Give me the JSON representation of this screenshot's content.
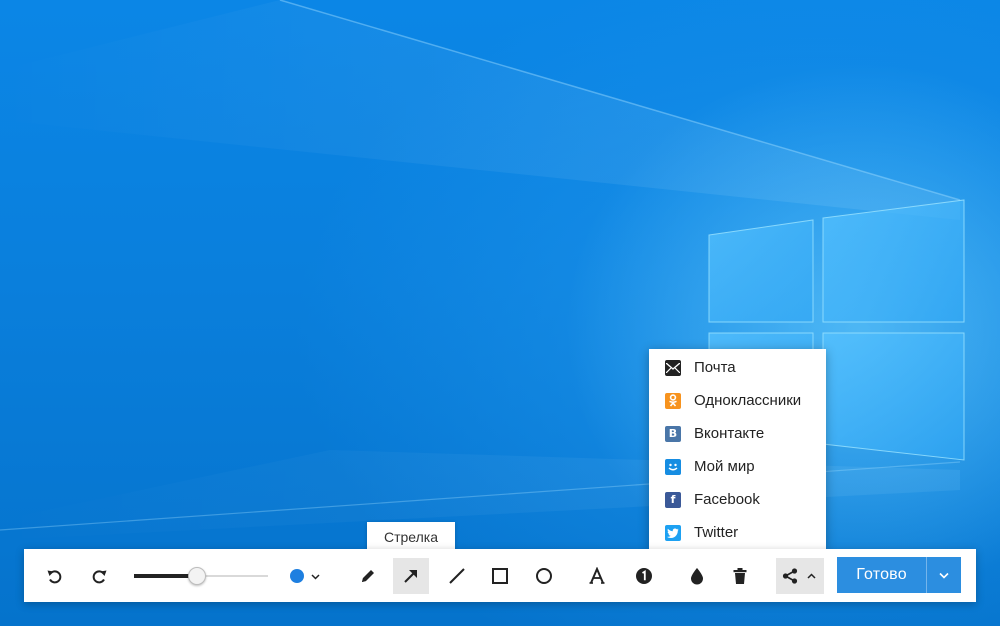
{
  "tooltip": {
    "text": "Стрелка"
  },
  "toolbar": {
    "brush_size": {
      "fraction": 0.47
    },
    "current_color": "#1e7fe0",
    "done_label": "Готово",
    "tools": [
      {
        "icon": "undo-icon"
      },
      {
        "icon": "redo-icon"
      },
      {
        "icon": "pencil-icon"
      },
      {
        "icon": "arrow-icon",
        "active": true
      },
      {
        "icon": "line-icon"
      },
      {
        "icon": "rectangle-icon"
      },
      {
        "icon": "ellipse-icon"
      },
      {
        "icon": "text-icon"
      },
      {
        "icon": "counter-icon"
      },
      {
        "icon": "blur-drop-icon"
      },
      {
        "icon": "trash-icon"
      },
      {
        "icon": "share-icon"
      }
    ]
  },
  "share_menu": {
    "items": [
      {
        "label": "Почта",
        "icon": "mail-icon",
        "color": "#222222"
      },
      {
        "label": "Одноклассники",
        "icon": "odnoklassniki-icon",
        "color": "#f7931e"
      },
      {
        "label": "Вконтакте",
        "icon": "vk-icon",
        "color": "#4a76a8"
      },
      {
        "label": "Мой мир",
        "icon": "moy-mir-icon",
        "color": "#168de2"
      },
      {
        "label": "Facebook",
        "icon": "facebook-icon",
        "color": "#3b5998"
      },
      {
        "label": "Twitter",
        "icon": "twitter-icon",
        "color": "#1da1f2"
      }
    ]
  },
  "colors": {
    "accent": "#2c8ee0",
    "wallpaper": "#0a7fdc"
  }
}
